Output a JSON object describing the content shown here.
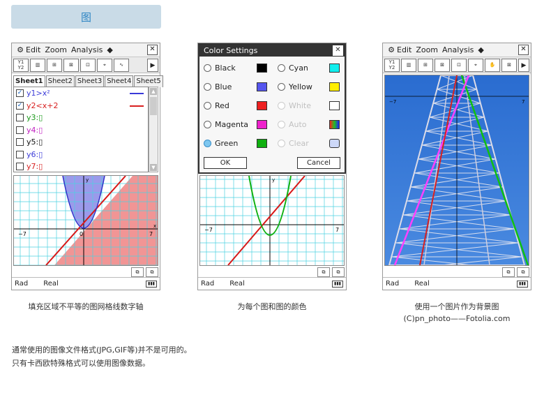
{
  "tab_label": "图",
  "screen1": {
    "menu": [
      "Edit",
      "Zoom",
      "Analysis",
      "◆"
    ],
    "sheets": [
      "Sheet1",
      "Sheet2",
      "Sheet3",
      "Sheet4",
      "Sheet5"
    ],
    "equations": [
      {
        "label": "y1>x²",
        "checked": true,
        "color": "#3a3ad8"
      },
      {
        "label": "y2<x+2",
        "checked": true,
        "color": "#d82020"
      },
      {
        "label": "y3:▯",
        "checked": false,
        "color": "#1a9a1a"
      },
      {
        "label": "y4:▯",
        "checked": false,
        "color": "#c020c0"
      },
      {
        "label": "y5:▯",
        "checked": false,
        "color": "#111111"
      },
      {
        "label": "y6:▯",
        "checked": false,
        "color": "#3a3ad8"
      },
      {
        "label": "y7:▯",
        "checked": false,
        "color": "#d82020"
      }
    ],
    "status": [
      "Rad",
      "Real"
    ]
  },
  "screen2": {
    "dialog_title": "Color Settings",
    "left_options": [
      {
        "label": "Black",
        "color": "#000000",
        "selected": false
      },
      {
        "label": "Blue",
        "color": "#5555ee",
        "selected": false
      },
      {
        "label": "Red",
        "color": "#ee2020",
        "selected": false
      },
      {
        "label": "Magenta",
        "color": "#ee20cc",
        "selected": false
      },
      {
        "label": "Green",
        "color": "#10b010",
        "selected": true
      }
    ],
    "right_options": [
      {
        "label": "Cyan",
        "color": "#10eeee",
        "dim": false
      },
      {
        "label": "Yellow",
        "color": "#ffee00",
        "dim": false
      },
      {
        "label": "White",
        "color": "#ffffff",
        "dim": true
      },
      {
        "label": "Auto",
        "color": "gradient",
        "dim": true
      },
      {
        "label": "Clear",
        "color": "clear",
        "dim": true
      }
    ],
    "ok": "OK",
    "cancel": "Cancel",
    "status": [
      "Rad",
      "Real"
    ]
  },
  "screen3": {
    "menu": [
      "Edit",
      "Zoom",
      "Analysis",
      "◆"
    ],
    "status": [
      "Rad",
      "Real"
    ]
  },
  "axes": {
    "x_min_label": "−7",
    "x_max_label": "7",
    "x_name": "x",
    "y_name": "y",
    "origin": "0"
  },
  "captions": {
    "c1": "填充区域不平等的图网格线数字轴",
    "c2": "为每个图和图的颜色",
    "c3a": "使用一个图片作为背景图",
    "c3b": "(C)pn_photo——Fotolia.com"
  },
  "notes": {
    "line1": "通常使用的图像文件格式(JPG,GIF等)并不是可用的。",
    "line2": "只有卡西欧特殊格式可以使用图像数据。"
  }
}
